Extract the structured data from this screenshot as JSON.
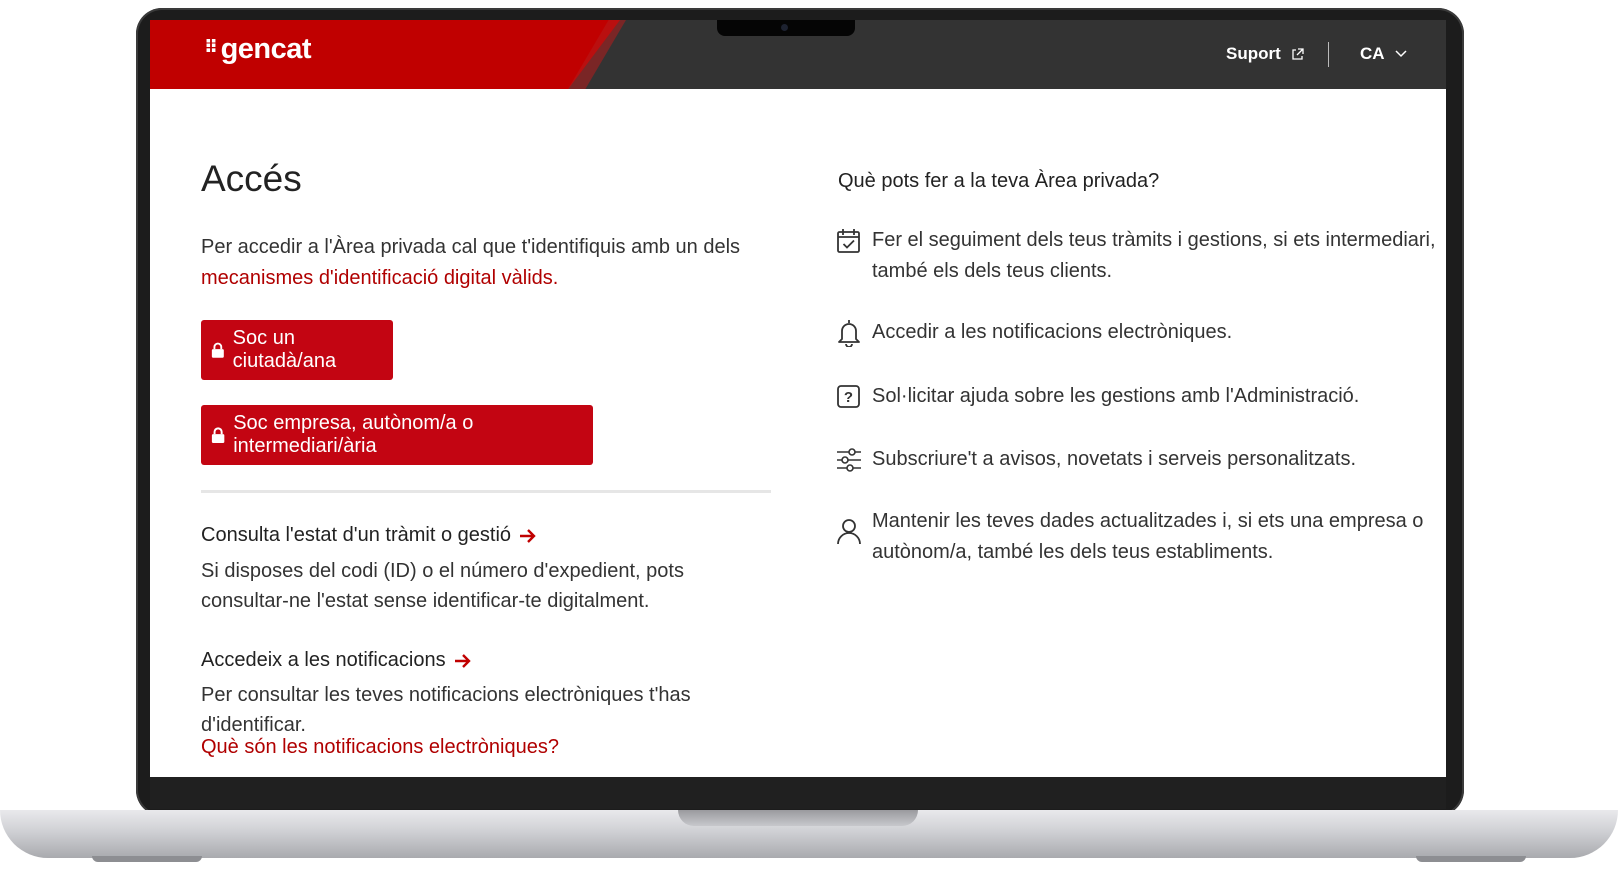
{
  "header": {
    "logo_mark": "⠿",
    "logo": "gencat",
    "support_label": "Suport",
    "language": "CA"
  },
  "left": {
    "title": "Accés",
    "intro_text": "Per accedir a l'Àrea privada cal que t'identifiquis amb un dels ",
    "intro_link": "mecanismes d'identificació digital vàlids.",
    "button_citizen": "Soc un ciutadà/ana",
    "button_company": "Soc empresa, autònom/a o intermediari/ària",
    "status": {
      "title": "Consulta l'estat d'un tràmit o gestió",
      "body": "Si disposes del codi (ID) o el número d'expedient, pots consultar-ne l'estat sense identificar-te digitalment."
    },
    "notifications": {
      "title": "Accedeix a les notificacions",
      "body": "Per consultar les teves notificacions electròniques t'has d'identificar."
    },
    "what_link": "Què són les notificacions electròniques?"
  },
  "right": {
    "title": "Què pots fer a la teva Àrea privada?",
    "features": [
      {
        "icon": "calendar-check-icon",
        "text": "Fer el seguiment dels teus tràmits i gestions, si ets intermediari, també els dels teus clients."
      },
      {
        "icon": "bell-icon",
        "text": "Accedir a les notificacions electròniques."
      },
      {
        "icon": "question-box-icon",
        "text": "Sol·licitar ajuda sobre les gestions amb l'Administració."
      },
      {
        "icon": "sliders-icon",
        "text": "Subscriure't a avisos, novetats i serveis personalitzats."
      },
      {
        "icon": "user-icon",
        "text": "Mantenir les teves dades actualitzades i, si ets una empresa o autònom/a, també les dels teus establiments."
      }
    ]
  },
  "colors": {
    "brand_red": "#c00000",
    "button_red": "#c30512",
    "header_dark": "#333333"
  }
}
